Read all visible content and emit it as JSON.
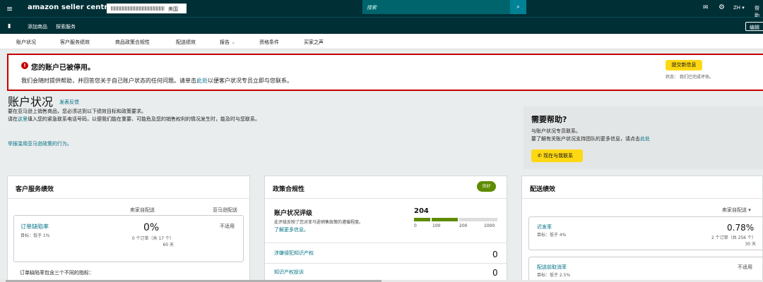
{
  "topbar": {
    "menu_icon": "hamburger-icon",
    "logo": "amazon seller central",
    "store_region": "美国",
    "search_placeholder": "搜索",
    "search_icon": "search-icon",
    "mail_icon": "mail-icon",
    "settings_icon": "gear-icon",
    "language": "ZH ▾",
    "help": "帮助"
  },
  "bar2": {
    "bookmark_icon": "bookmark-icon",
    "items": [
      "添加商品",
      "探索服务"
    ],
    "edit": "编辑"
  },
  "tabs": [
    "账户状况",
    "客户服务绩效",
    "商品政策合规性",
    "配送绩效",
    "报告",
    "资格条件",
    "买家之声"
  ],
  "alert": {
    "title": "您的账户已被停用。",
    "msg_prefix": "我们会随时提供帮助，并回答您关于自己账户状态的任何问题。请单击",
    "msg_link": "此处",
    "msg_suffix": "以便客户状况专员立即与您联系。",
    "submit_button": "提交新信息",
    "status": "状态：  我们已完成评估。"
  },
  "page": {
    "title": "账户状况",
    "feedback": "发表反馈",
    "intro_line1": "要在亚马逊上销售商品，您必须达到以下绩效目标和政策要求。",
    "intro_line2_a": "请在",
    "intro_line2_link": "这里",
    "intro_line2_b": "填入您的紧急联系电话号码，以便我们能在重要、可能危及您的销售权利的情况发生时，能及时与您联系。",
    "report_link": "举报滥用亚马逊政策的行为。"
  },
  "help_box": {
    "title": "需要帮助?",
    "line1": "与账户状况专员联系。",
    "line2_a": "要了解有关账户状况支持团队的更多信息，请点击",
    "line2_link": "此处",
    "contact_button": "现在与我联系",
    "phone_icon": "phone-icon"
  },
  "customer_service": {
    "title": "客户服务绩效",
    "col_seller": "卖家自配送",
    "col_amazon": "亚马逊配送",
    "metric_name": "订单缺陷率",
    "metric_target": "目标：低于 1%",
    "metric_value": "0%",
    "metric_detail": "0 个订单（共 17 个）",
    "metric_days": "60 天",
    "amazon_value": "不适用",
    "footer": "订单缺陷率包含三个不同的指标："
  },
  "policy": {
    "title": "政策合规性",
    "badge": "良好",
    "rating_title": "账户状况评级",
    "rating_desc": "此评级反映了您对亚马逊销售政策的遵循程度。",
    "rating_link": "了解更多信息。",
    "score": "204",
    "score_value": 204,
    "ticks": [
      "0",
      "100",
      "200",
      "1000"
    ],
    "rows": [
      {
        "label": "涉嫌侵犯知识产权",
        "value": "0"
      },
      {
        "label": "知识产权投诉",
        "value": "0"
      }
    ]
  },
  "shipping": {
    "title": "配送绩效",
    "dropdown": "卖家自配送 ▾",
    "metric1_name": "迟发率",
    "metric1_target": "目标：低于 4%",
    "metric1_value": "0.78%",
    "metric1_detail": "2 个订单（共 256 个）",
    "metric1_days": "30 天",
    "metric2_name": "配送前取消率",
    "metric2_target": "目标：低于 2.5%",
    "metric2_value": "不适用"
  },
  "colors": {
    "topbar": "#002f36",
    "alert_red": "#c40000",
    "link": "#007185",
    "button_yellow": "#ffd814",
    "good_green": "#5e8c00"
  }
}
